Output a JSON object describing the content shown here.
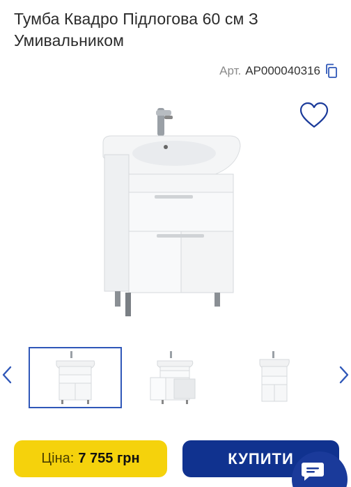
{
  "product": {
    "title": "Тумба Квадро Підлогова 60 см З Умивальником",
    "article_label": "Арт.",
    "article_value": "AP000040316"
  },
  "icons": {
    "copy": "copy-icon",
    "favorite": "heart-icon",
    "prev": "chevron-left-icon",
    "next": "chevron-right-icon",
    "chat": "chat-icon"
  },
  "gallery": {
    "thumbnails": [
      "cabinet-front",
      "cabinet-open-door",
      "cabinet-front-small"
    ],
    "active_index": 0
  },
  "purchase": {
    "price_label": "Ціна:",
    "price_value": "7 755 грн",
    "buy_label": "КУПИТИ"
  },
  "colors": {
    "price_bg": "#f5d20c",
    "buy_bg": "#10328f",
    "accent": "#2f57b8"
  }
}
